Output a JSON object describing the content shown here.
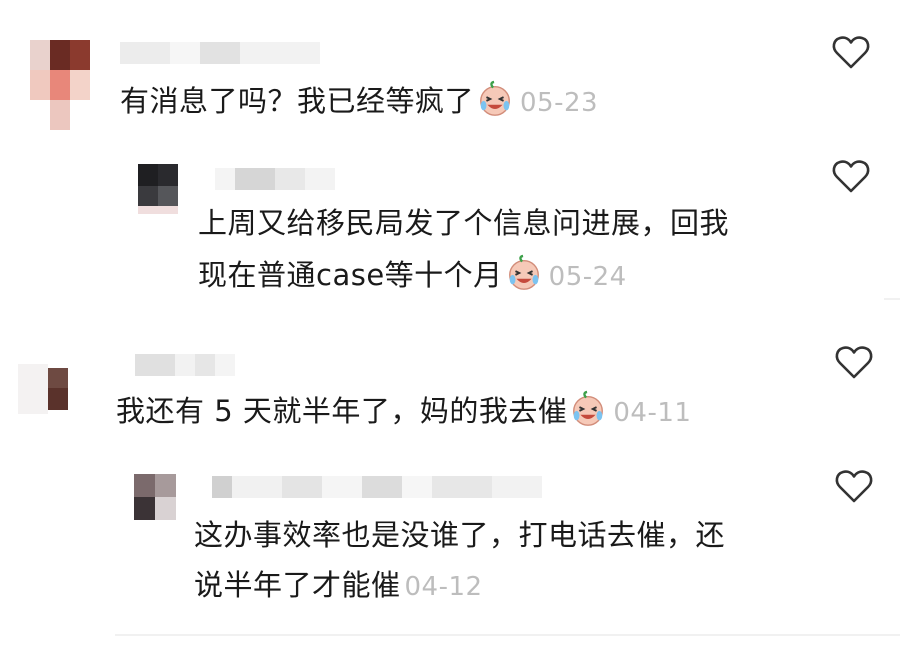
{
  "comments": [
    {
      "text": "有消息了吗？我已经等疯了",
      "emoji": "crying-laughing-face-icon",
      "date": "05-23",
      "reply_level": 0
    },
    {
      "text_line1": "上周又给移民局发了个信息问进展，回我",
      "text_line2": "现在普通case等十个月",
      "emoji": "crying-laughing-face-icon",
      "date": "05-24",
      "reply_level": 1
    },
    {
      "text": "我还有 5 天就半年了，妈的我去催",
      "emoji": "crying-laughing-face-icon",
      "date": "04-11",
      "reply_level": 0
    },
    {
      "text_line1": "这办事效率也是没谁了，打电话去催，还",
      "text_line2": "说半年了才能催",
      "date": "04-12",
      "reply_level": 1
    }
  ],
  "icons": {
    "like": "heart-outline-icon"
  },
  "colors": {
    "text": "#1a1a1a",
    "date": "#bdbdbd",
    "icon_stroke": "#333333"
  }
}
